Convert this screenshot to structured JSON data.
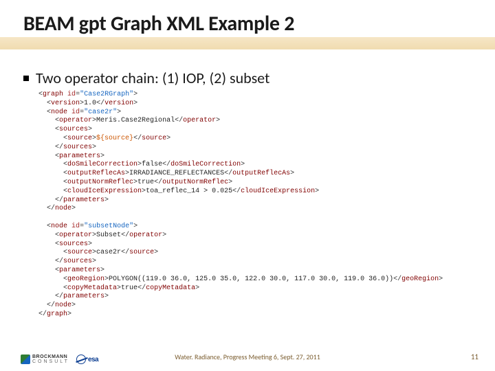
{
  "title": "BEAM gpt Graph XML Example 2",
  "bullet": "Two operator chain: (1) IOP, (2) subset",
  "code": {
    "graph_open_tag": "graph",
    "graph_id_attr": "id",
    "graph_id_val": "\"Case2RGraph\"",
    "version_tag": "version",
    "version_val": "1.0",
    "node_tag": "node",
    "node1_id_val": "\"case2r\"",
    "operator_tag": "operator",
    "operator1_val": "Meris.Case2Regional",
    "sources_tag": "sources",
    "source_tag": "source",
    "source1_val": "${source}",
    "parameters_tag": "parameters",
    "doSmile_tag": "doSmileCorrection",
    "doSmile_val": "false",
    "outputReflecAs_tag": "outputReflecAs",
    "outputReflecAs_val": "IRRADIANCE_REFLECTANCES",
    "outputNormReflec_tag": "outputNormReflec",
    "outputNormReflec_val": "true",
    "cloudIce_tag": "cloudIceExpression",
    "cloudIce_val": "toa_reflec_14 > 0.025",
    "node2_id_val": "\"subsetNode\"",
    "operator2_val": "Subset",
    "source2_val": "case2r",
    "geoRegion_tag": "geoRegion",
    "geoRegion_val": "POLYGON((119.0 36.0, 125.0 35.0, 122.0 30.0, 117.0 30.0, 119.0 36.0))",
    "copyMetadata_tag": "copyMetadata",
    "copyMetadata_val": "true"
  },
  "footer": {
    "brockmann_top": "BROCKMANN",
    "brockmann_bot": "CONSULT",
    "esa": "esa",
    "center": "Water. Radiance, Progress Meeting 6,   Sept. 27, 2011",
    "page": "11"
  }
}
